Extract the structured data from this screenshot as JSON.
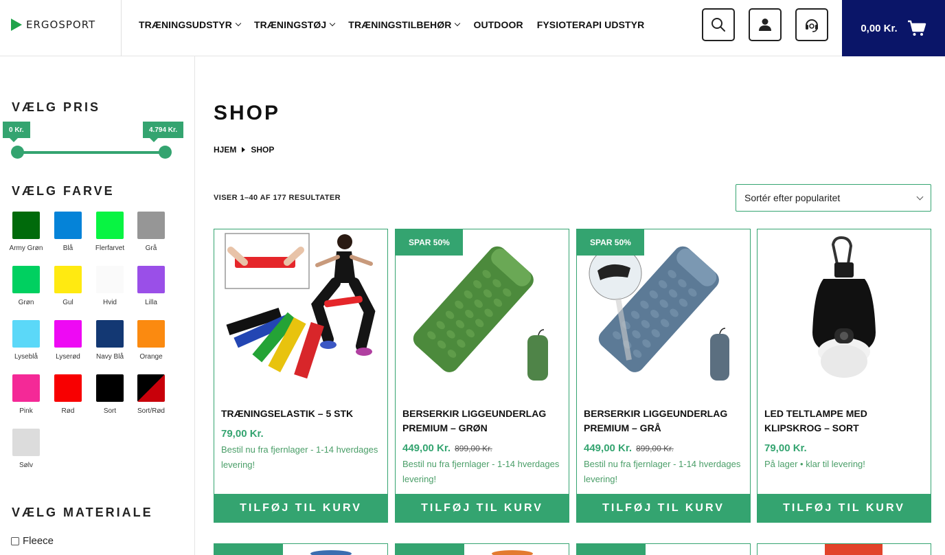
{
  "header": {
    "logo": "ERGOSPORT",
    "nav": [
      {
        "label": "TRÆNINGSUDSTYR",
        "dropdown": true
      },
      {
        "label": "TRÆNINGSTØJ",
        "dropdown": true
      },
      {
        "label": "TRÆNINGSTILBEHØR",
        "dropdown": true
      },
      {
        "label": "OUTDOOR",
        "dropdown": false
      },
      {
        "label": "FYSIOTERAPI UDSTYR",
        "dropdown": false
      }
    ],
    "icons": [
      "search-icon",
      "user-icon",
      "support-headset-icon"
    ],
    "cart_amount": "0,00 Kr."
  },
  "sidebar": {
    "price_title": "VÆLG PRIS",
    "price_min": "0 Kr.",
    "price_max": "4.794 Kr.",
    "color_title": "VÆLG FARVE",
    "colors": [
      {
        "label": "Army Grøn",
        "hex": "#006a0b"
      },
      {
        "label": "Blå",
        "hex": "#0583d8"
      },
      {
        "label": "Flerfarvet",
        "hex": "#08f442"
      },
      {
        "label": "Grå",
        "hex": "#969696"
      },
      {
        "label": "Grøn",
        "hex": "#00d060"
      },
      {
        "label": "Gul",
        "hex": "#ffea11"
      },
      {
        "label": "Hvid",
        "hex": "#fafafa"
      },
      {
        "label": "Lilla",
        "hex": "#9a4fe8"
      },
      {
        "label": "Lyseblå",
        "hex": "#5bd8f8"
      },
      {
        "label": "Lyserød",
        "hex": "#ee09f4"
      },
      {
        "label": "Navy Blå",
        "hex": "#133873"
      },
      {
        "label": "Orange",
        "hex": "#fb8a10"
      },
      {
        "label": "Pink",
        "hex": "#f42997"
      },
      {
        "label": "Rød",
        "hex": "#f80001"
      },
      {
        "label": "Sort",
        "hex": "#000000"
      },
      {
        "label": "Sort/Rød",
        "hex": "split"
      },
      {
        "label": "Sølv",
        "hex": "#dcdcdc"
      }
    ],
    "material_title": "VÆLG MATERIALE",
    "materials": [
      "Fleece"
    ]
  },
  "main": {
    "title": "SHOP",
    "breadcrumb": [
      "HJEM",
      "SHOP"
    ],
    "result_count": "VISER 1–40 AF 177 RESULTATER",
    "sort_label": "Sortér efter popularitet",
    "add_to_cart": "TILFØJ TIL KURV",
    "products": [
      {
        "name": "TRÆNINGSELASTIK – 5 STK",
        "price": "79,00 Kr.",
        "old_price": "",
        "badge": "",
        "stock": "Bestil nu fra fjernlager - 1-14 hverdages levering!",
        "image": "resistance-bands"
      },
      {
        "name": "BERSERKIR LIGGEUNDERLAG PREMIUM – GRØN",
        "price": "449,00 Kr.",
        "old_price": "899,00 Kr.",
        "badge": "SPAR 50%",
        "stock": "Bestil nu fra fjernlager - 1-14 hverdages levering!",
        "image": "sleeping-pad-green"
      },
      {
        "name": "BERSERKIR LIGGEUNDERLAG PREMIUM – GRÅ",
        "price": "449,00 Kr.",
        "old_price": "899,00 Kr.",
        "badge": "SPAR 50%",
        "stock": "Bestil nu fra fjernlager - 1-14 hverdages levering!",
        "image": "sleeping-pad-grey"
      },
      {
        "name": "LED TELTLAMPE MED KLIPSKROG – SORT",
        "price": "79,00 Kr.",
        "old_price": "",
        "badge": "",
        "stock": "På lager • klar til levering!",
        "image": "tent-lamp"
      }
    ]
  }
}
